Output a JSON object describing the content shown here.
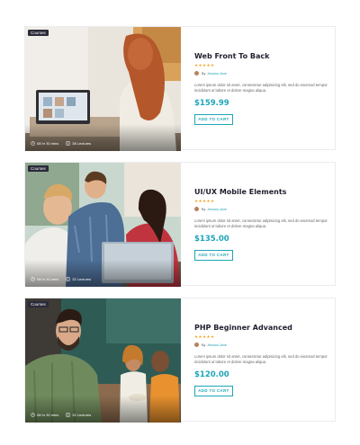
{
  "courses": [
    {
      "badge": "Courses",
      "duration": "08 hr 30 mins",
      "lectures": "38 Lectures",
      "title": "Web Front To Back",
      "rating": 5,
      "author_prefix": "By",
      "author": "Jessica Jane",
      "excerpt": "Lorem ipsum dolor sit amet, consectetur adipisicing elit, sed do eiusmod tempor incididunt ut labore et dolore magna aliqua.",
      "price": "$159.99",
      "cta": "ADD TO CART"
    },
    {
      "badge": "Courses",
      "duration": "08 hr 30 mins",
      "lectures": "32 Lectures",
      "title": "UI/UX Mobile Elements",
      "rating": 5,
      "author_prefix": "By",
      "author": "Jessica Jane",
      "excerpt": "Lorem ipsum dolor sit amet, consectetur adipisicing elit, sed do eiusmod tempor incididunt ut labore et dolore magna aliqua.",
      "price": "$135.00",
      "cta": "ADD TO CART"
    },
    {
      "badge": "Courses",
      "duration": "08 hr 30 mins",
      "lectures": "32 Lectures",
      "title": "PHP Beginner Advanced",
      "rating": 5,
      "author_prefix": "By",
      "author": "Jessica Jane",
      "excerpt": "Lorem ipsum dolor sit amet, consectetur adipisicing elit, sed do eiusmod tempor incididunt ut labore et dolore magna aliqua.",
      "price": "$120.00",
      "cta": "ADD TO CART"
    }
  ],
  "icons": {
    "star": "star-icon",
    "clock": "clock-icon",
    "book": "book-icon"
  },
  "colors": {
    "accent": "#1ea5b8",
    "star": "#f5a623",
    "badge_bg": "#2a2a3a"
  }
}
